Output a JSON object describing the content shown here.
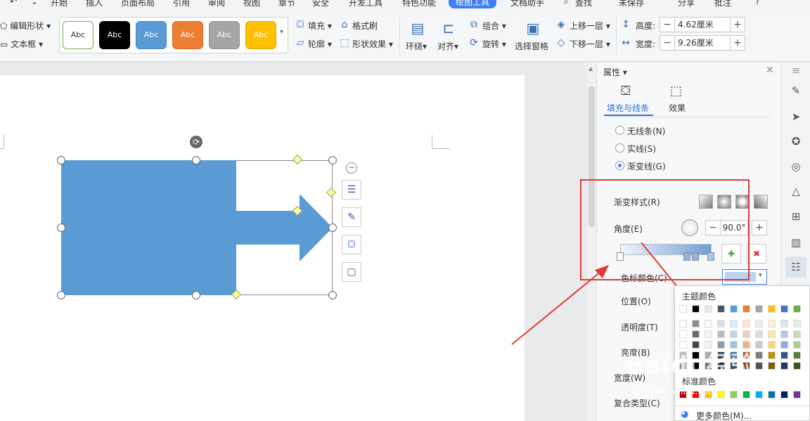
{
  "menubar": {
    "items": [
      "开始",
      "插入",
      "页面布局",
      "引用",
      "审阅",
      "视图",
      "章节",
      "安全",
      "开发工具",
      "特色功能",
      "绘图工具",
      "文档助手",
      "查找",
      "未保存",
      "分享",
      "批注",
      "?"
    ],
    "active_index": 10
  },
  "ribbon": {
    "edit_shape": "编辑形状",
    "text_box": "文本框",
    "style_presets": [
      {
        "label": "Abc",
        "bg": "#ffffff",
        "fg": "#333333",
        "border": "#70ad47"
      },
      {
        "label": "Abc",
        "bg": "#000000",
        "fg": "#ffffff",
        "border": "#000000"
      },
      {
        "label": "Abc",
        "bg": "#5b9bd5",
        "fg": "#ffffff",
        "border": "#4a86bf"
      },
      {
        "label": "Abc",
        "bg": "#ed7d31",
        "fg": "#ffffff",
        "border": "#d26a22"
      },
      {
        "label": "Abc",
        "bg": "#a5a5a5",
        "fg": "#ffffff",
        "border": "#8f8f8f"
      },
      {
        "label": "Abc",
        "bg": "#ffc000",
        "fg": "#ffffff",
        "border": "#e0a800"
      }
    ],
    "fill": "填充",
    "outline": "轮廓",
    "format_brush": "格式刷",
    "shape_effects": "形状效果",
    "wrap": "环绕",
    "align": "对齐",
    "group": "组合",
    "rotate": "旋转",
    "selection_pane": "选择窗格",
    "bring_forward": "上移一层",
    "send_backward": "下移一层",
    "height_label": "高度:",
    "height_value": "4.62厘米",
    "width_label": "宽度:",
    "width_value": "9.26厘米"
  },
  "panel": {
    "title": "属性",
    "tab_fill_line": "填充与线条",
    "tab_effects": "效果",
    "no_line": "无线条(N)",
    "solid_line": "实线(S)",
    "gradient_line": "渐变线(G)",
    "gradient_style": "渐变样式(R)",
    "angle": "角度(E)",
    "angle_value": "90.0°",
    "stop_color": "色标颜色(C)",
    "position": "位置(O)",
    "transparency": "透明度(T)",
    "brightness": "亮度(B)",
    "width": "宽度(W)",
    "compound_type": "复合类型(C)"
  },
  "color_popup": {
    "theme_colors": "主题颜色",
    "standard_colors": "标准颜色",
    "more_colors": "更多颜色(M)...",
    "theme_top": [
      "#ffffff",
      "#000000",
      "#e7e6e6",
      "#44546a",
      "#5b9bd5",
      "#ed7d31",
      "#a5a5a5",
      "#ffc000",
      "#4472c4",
      "#70ad47"
    ],
    "standard": [
      "#c00000",
      "#ff0000",
      "#ffc000",
      "#ffff00",
      "#92d050",
      "#00b050",
      "#00b0f0",
      "#0070c0",
      "#002060",
      "#7030a0"
    ]
  },
  "watermark": "Baidu经验",
  "watermark_sub": "jingyan.baidu.com"
}
